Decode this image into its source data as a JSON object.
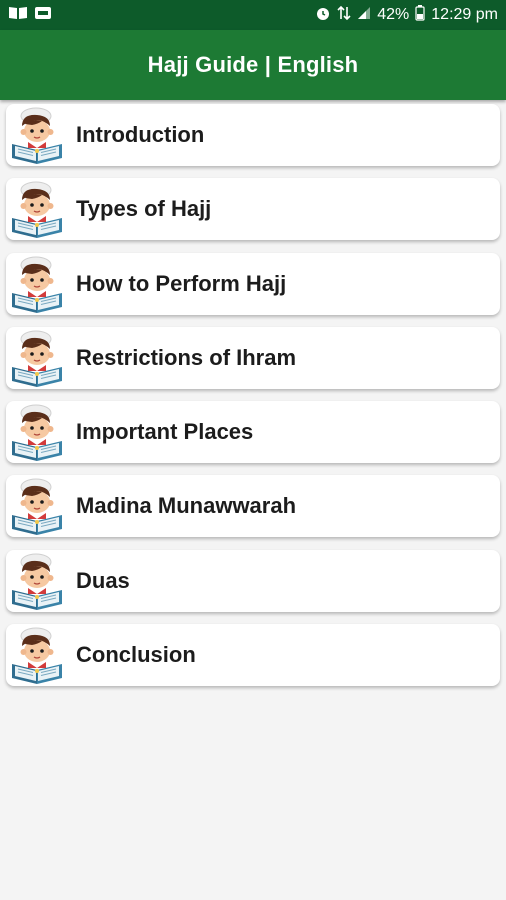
{
  "status_bar": {
    "battery": "42%",
    "time": "12:29 pm",
    "icons": [
      "book-icon",
      "wallet-icon",
      "alarm-icon",
      "data-signal-icon",
      "cell-signal-icon",
      "battery-icon"
    ]
  },
  "app_bar": {
    "title": "Hajj Guide | English"
  },
  "menu": {
    "items": [
      {
        "label": "Introduction"
      },
      {
        "label": "Types of Hajj"
      },
      {
        "label": "How to Perform Hajj"
      },
      {
        "label": "Restrictions of Ihram"
      },
      {
        "label": "Important Places"
      },
      {
        "label": "Madina Munawwarah"
      },
      {
        "label": "Duas"
      },
      {
        "label": "Conclusion"
      }
    ]
  },
  "colors": {
    "status_bar": "#0d5b2a",
    "app_bar": "#1d7a34",
    "background": "#f4f4f4",
    "card": "#ffffff"
  }
}
